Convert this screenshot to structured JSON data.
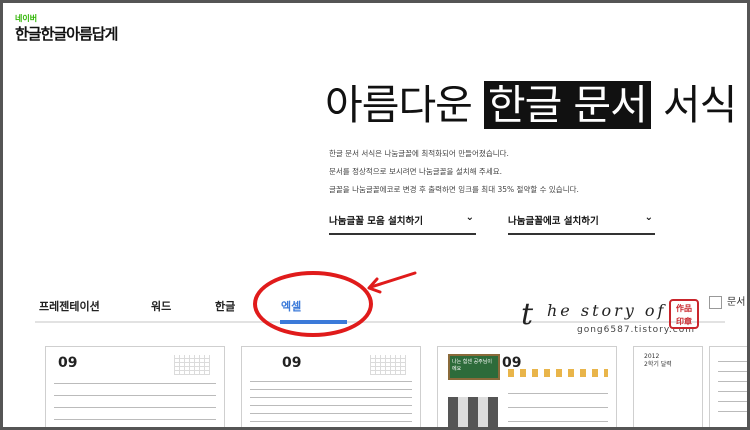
{
  "logo": {
    "small": "네이버",
    "main": "한글한글아름답게"
  },
  "hero": {
    "before": "아름다운 ",
    "highlight": "한글 문서",
    "after": " 서식"
  },
  "description": [
    "한글 문서 서식은 나눔글꼴에 최적화되어 만들어졌습니다.",
    "문서를 정상적으로 보시려면 나눔글꼴을 설치해 주세요.",
    "글꼴을 나눔글꼴에코로 변경 후 출력하면 잉크를 최대 35% 절약할 수 있습니다."
  ],
  "downloads": [
    {
      "label": "나눔글꼴 모음 설치하기",
      "icon": "chevron-down-icon"
    },
    {
      "label": "나눔글꼴에코 설치하기",
      "icon": "chevron-down-icon"
    }
  ],
  "tabs": [
    {
      "label": "프레젠테이션",
      "active": false
    },
    {
      "label": "워드",
      "active": false
    },
    {
      "label": "한글",
      "active": false
    },
    {
      "label": "엑셀",
      "active": true
    }
  ],
  "checkbox": {
    "label": "문서 서"
  },
  "watermark": {
    "brand": "he story of",
    "url": "gong6587.tistory.com",
    "seal": "作品 印章"
  },
  "thumbnails": [
    {
      "title": "09"
    },
    {
      "title": "09"
    },
    {
      "title": "09",
      "board_text": "나는 힘센 공주님이에요"
    },
    {
      "title": "2012",
      "subtitle": "2학기 달력"
    }
  ],
  "colors": {
    "accent": "#3b7ad9",
    "annotation": "#e01b1b",
    "text": "#111111"
  }
}
